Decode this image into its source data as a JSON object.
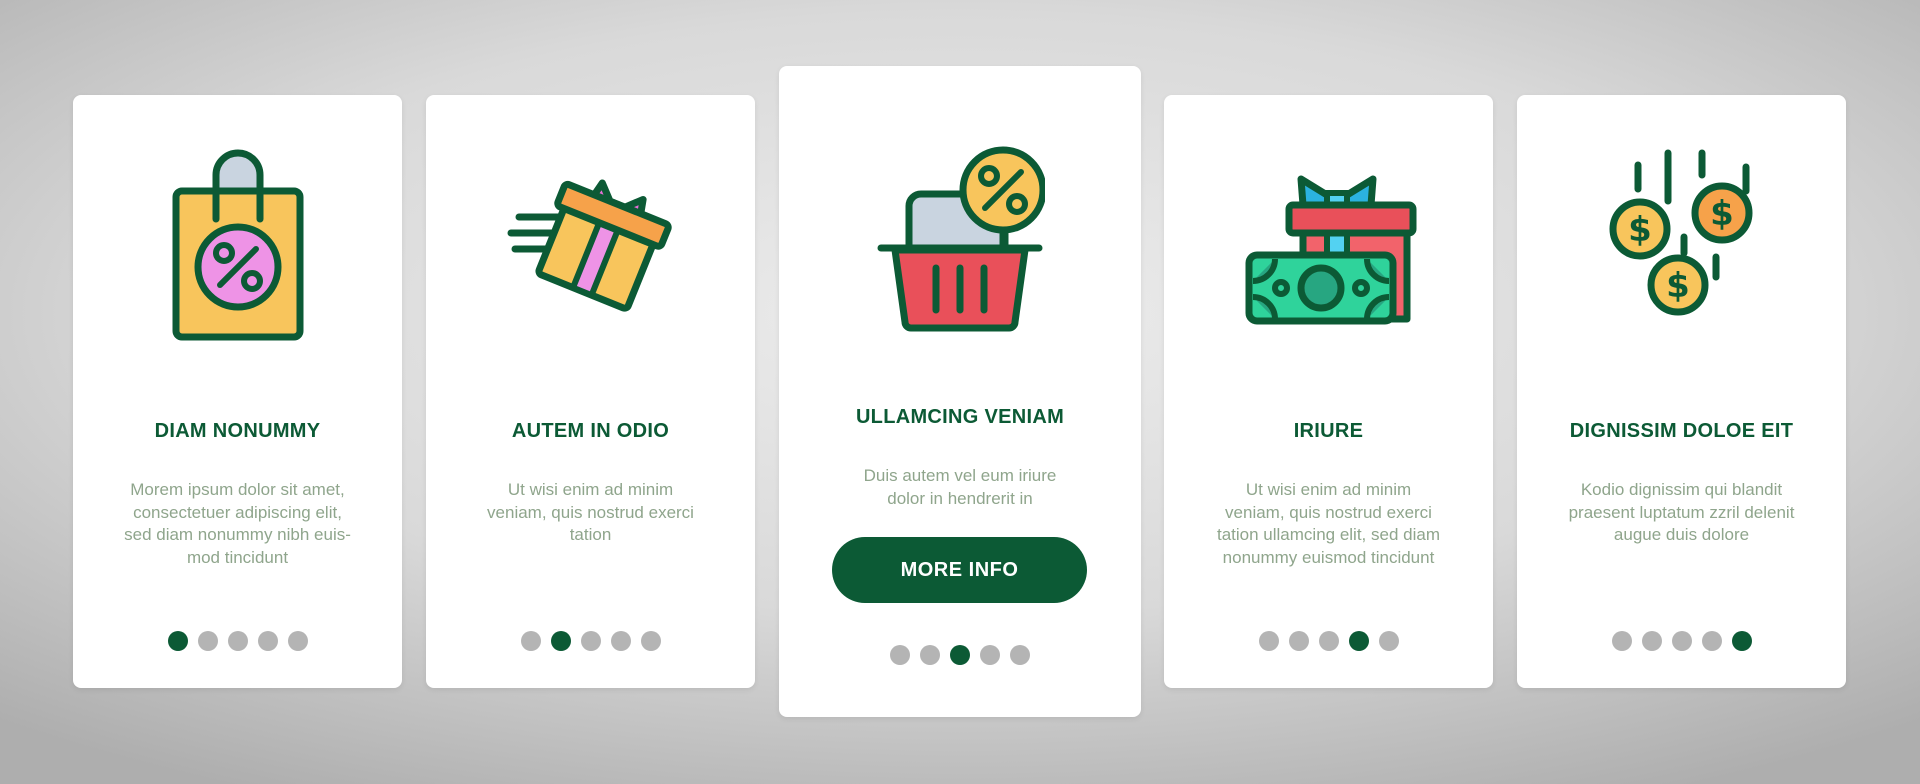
{
  "colors": {
    "primary": "#0c5a35",
    "body_text": "#8fa58c",
    "dot_inactive": "#b4b4b4",
    "card_bg": "#ffffff"
  },
  "cards": [
    {
      "icon": "shopping-bag-percent-icon",
      "title": "DIAM NONUMMY",
      "body_lines": [
        "Morem ipsum dolor sit amet,",
        "consectetuer adipiscing elit,",
        "sed diam nonummy nibh euis-",
        "mod tincidunt"
      ],
      "active_dot": 1,
      "dot_count": 5
    },
    {
      "icon": "flying-gift-box-icon",
      "title": "AUTEM IN ODIO",
      "body_lines": [
        "Ut wisi enim ad minim",
        "veniam, quis nostrud exerci",
        "tation"
      ],
      "active_dot": 2,
      "dot_count": 5
    },
    {
      "icon": "shopping-basket-discount-icon",
      "title": "ULLAMCING VENIAM",
      "body_lines": [
        "Duis autem vel eum iriure",
        "dolor in hendrerit in"
      ],
      "button_label": "MORE INFO",
      "active_dot": 3,
      "dot_count": 5
    },
    {
      "icon": "gift-and-money-icon",
      "title": "IRIURE",
      "body_lines": [
        "Ut wisi enim ad minim",
        "veniam, quis nostrud exerci",
        "tation ullamcing elit, sed diam",
        "nonummy euismod tincidunt"
      ],
      "active_dot": 4,
      "dot_count": 5
    },
    {
      "icon": "falling-coins-icon",
      "title": "DIGNISSIM DOLOE EIT",
      "body_lines": [
        "Kodio dignissim qui blandit",
        "praesent luptatum zzril delenit",
        "augue duis dolore"
      ],
      "active_dot": 5,
      "dot_count": 5
    }
  ]
}
